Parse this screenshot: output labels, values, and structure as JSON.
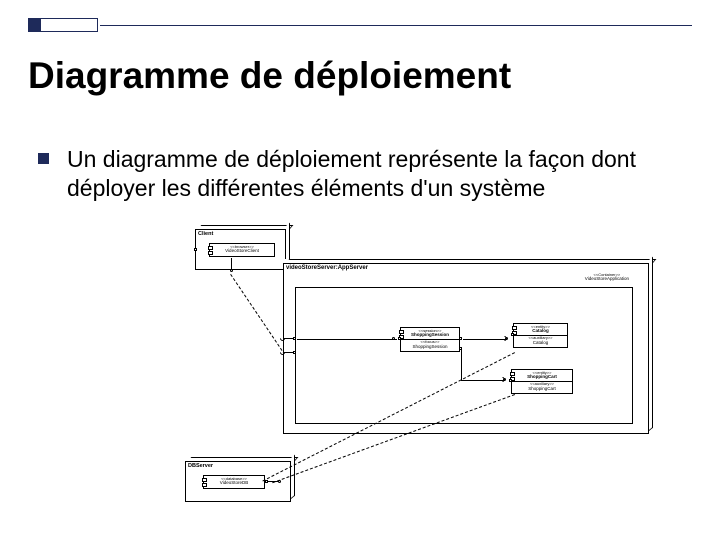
{
  "title": "Diagramme de déploiement",
  "bullet": "Un diagramme de déploiement représente la façon dont déployer les différentes éléments d'un système",
  "nodes": {
    "client": {
      "label": "Client",
      "component": {
        "stereo": "<<browser>>",
        "name": "VideoStoreClient"
      }
    },
    "appserver": {
      "label": "videoStoreServer:AppServer",
      "container": {
        "stereo": "<<Container>>",
        "name": "VideoStoreApplication"
      },
      "shopping": {
        "stereo1": "<<session>>",
        "name1": "ShoppingSession",
        "stereo2": "<<focus>>",
        "name2": "ShoppingSession"
      },
      "catalog": {
        "stereo1": "<<entity>>",
        "name1": "Catalog",
        "stereo2": "<<auxiliary>>",
        "name2": "Catalog"
      },
      "cart": {
        "stereo1": "<<entity>>",
        "name1": "ShoppingCart",
        "stereo2": "<<auxiliary>>",
        "name2": "ShoppingCart"
      }
    },
    "dbserver": {
      "label": "DBServer",
      "component": {
        "stereo": "<<database>>",
        "name": "VideoStoreDB"
      }
    }
  }
}
